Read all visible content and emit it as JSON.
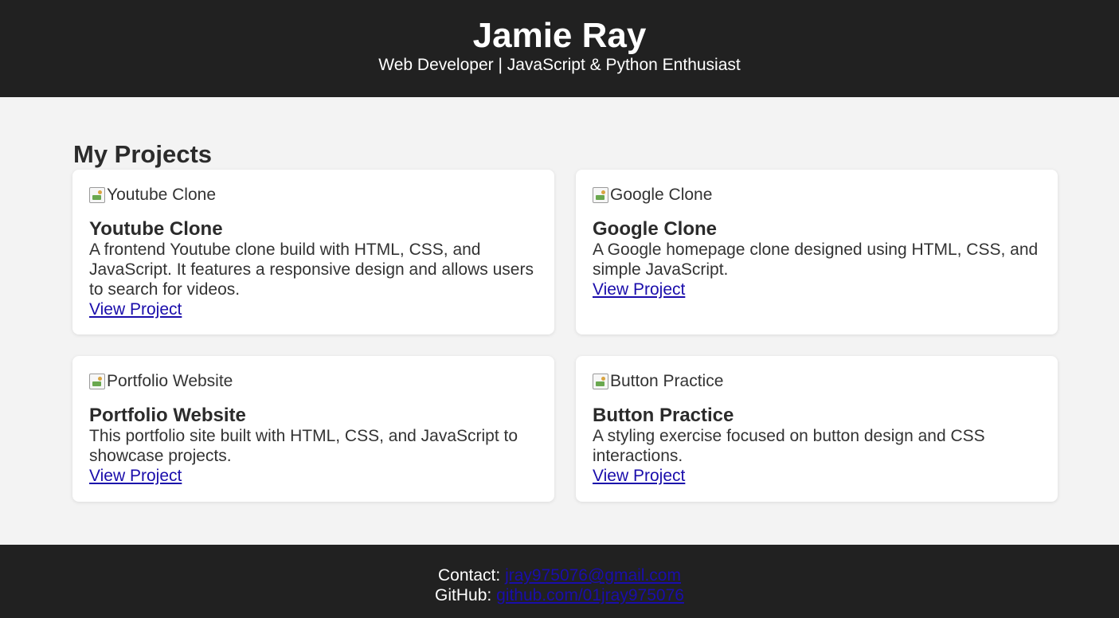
{
  "header": {
    "name": "Jamie Ray",
    "tagline": "Web Developer | JavaScript & Python Enthusiast"
  },
  "projects_section": {
    "title": "My Projects",
    "projects": [
      {
        "image_alt": "Youtube Clone",
        "title": "Youtube Clone",
        "description": "A frontend Youtube clone build with HTML, CSS, and JavaScript. It features a responsive design and allows users to search for videos.",
        "link_label": "View Project"
      },
      {
        "image_alt": "Google Clone",
        "title": "Google Clone",
        "description": "A Google homepage clone designed using HTML, CSS, and simple JavaScript.",
        "link_label": "View Project"
      },
      {
        "image_alt": "Portfolio Website",
        "title": "Portfolio Website",
        "description": "This portfolio site built with HTML, CSS, and JavaScript to showcase projects.",
        "link_label": "View Project"
      },
      {
        "image_alt": "Button Practice",
        "title": "Button Practice",
        "description": "A styling exercise focused on button design and CSS interactions.",
        "link_label": "View Project"
      }
    ]
  },
  "footer": {
    "contact_label": "Contact:",
    "email": "jray975076@gmail.com",
    "github_label": "GitHub:",
    "github": "github.com/01jray975076"
  },
  "colors": {
    "header_bg": "#212121",
    "page_bg": "#f3f3f3",
    "card_bg": "#ffffff",
    "link": "#1a0dab"
  },
  "icons": {
    "project_image": "broken-image-icon"
  }
}
